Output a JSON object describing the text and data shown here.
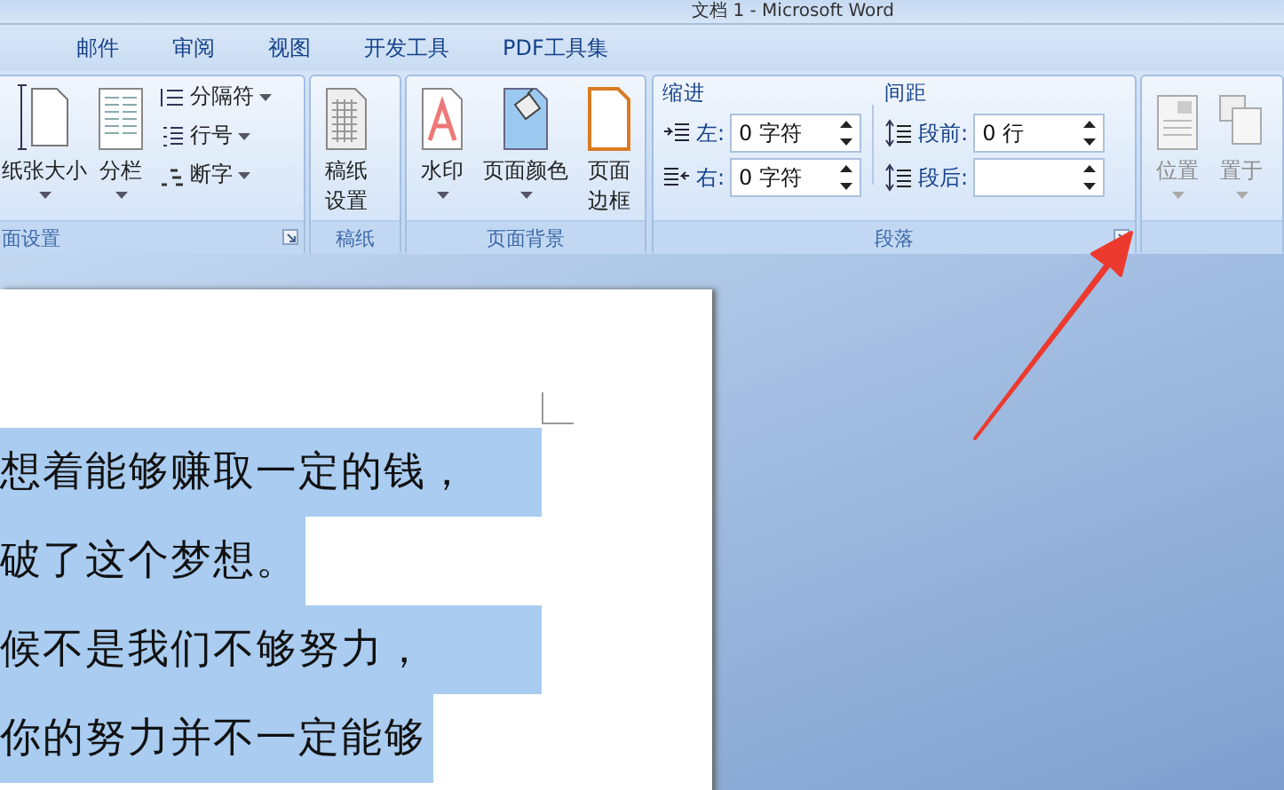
{
  "window": {
    "title": "文档 1 - Microsoft Word"
  },
  "tabs": [
    {
      "label": "邮件",
      "selected": false
    },
    {
      "label": "审阅",
      "selected": false
    },
    {
      "label": "视图",
      "selected": false
    },
    {
      "label": "开发工具",
      "selected": false
    },
    {
      "label": "PDF工具集",
      "selected": false
    }
  ],
  "ribbon": {
    "groups": [
      {
        "kind": "page-setup",
        "label": "面设置",
        "launcher": true,
        "big_buttons": [
          {
            "lines": [
              "纸张大小"
            ],
            "dropdown": true
          },
          {
            "lines": [
              "分栏"
            ],
            "dropdown": true
          }
        ],
        "small_buttons": [
          {
            "label": "分隔符",
            "dropdown": true
          },
          {
            "label": "行号",
            "dropdown": true
          },
          {
            "label": "断字",
            "dropdown": true
          }
        ]
      },
      {
        "kind": "buttons",
        "label": "稿纸",
        "launcher": false,
        "disabled": false,
        "buttons": [
          {
            "lines": [
              "稿纸",
              "设置"
            ],
            "dropdown": false
          }
        ]
      },
      {
        "kind": "buttons",
        "label": "页面背景",
        "launcher": false,
        "disabled": false,
        "buttons": [
          {
            "lines": [
              "水印"
            ],
            "dropdown": true
          },
          {
            "lines": [
              "页面颜色"
            ],
            "dropdown": true
          },
          {
            "lines": [
              "页面",
              "边框"
            ],
            "dropdown": false
          }
        ]
      },
      {
        "kind": "paragraph",
        "label": "段落",
        "launcher": true,
        "columns": [
          {
            "heading": "缩进",
            "fields": [
              {
                "label": "左:",
                "value": "0 字符"
              },
              {
                "label": "右:",
                "value": "0 字符"
              }
            ]
          },
          {
            "heading": "间距",
            "fields": [
              {
                "label": "段前:",
                "value": "0 行"
              },
              {
                "label": "段后:"
              }
            ]
          }
        ]
      },
      {
        "kind": "buttons",
        "launcher": false,
        "disabled": true,
        "buttons": [
          {
            "lines": [
              "位置"
            ],
            "dropdown": true
          },
          {
            "lines": [
              "置于"
            ],
            "dropdown": true
          }
        ]
      }
    ]
  },
  "document": {
    "lines": [
      {
        "text": "想着能够赚取一定的钱，",
        "selected": true
      },
      {
        "text": "破了这个梦想。",
        "selected": true
      },
      {
        "text": "候不是我们不够努力，",
        "selected": true
      },
      {
        "text": "你的努力并不一定能够",
        "selected": true
      }
    ]
  }
}
